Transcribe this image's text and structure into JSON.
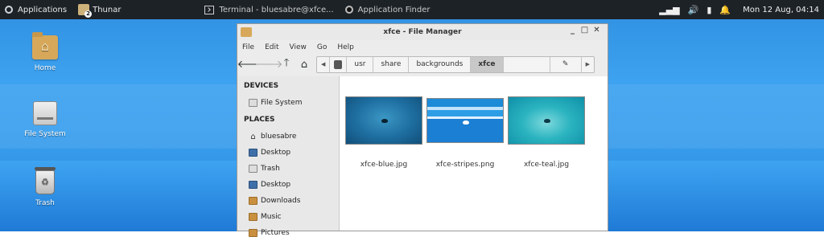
{
  "panel": {
    "applications_label": "Applications",
    "thunar_label": "Thunar",
    "thunar_badge": "2",
    "terminal_label": "Terminal - bluesabre@xfce...",
    "app_finder_label": "Application Finder",
    "clock": "Mon 12 Aug, 04:14",
    "tray_icons": [
      "signal-icon",
      "volume-icon",
      "battery-icon",
      "notification-bell-icon"
    ]
  },
  "desktop": {
    "icons": [
      {
        "label": "Home",
        "icon": "home-folder-icon"
      },
      {
        "label": "File System",
        "icon": "drive-icon"
      },
      {
        "label": "Trash",
        "icon": "trash-icon"
      }
    ]
  },
  "window": {
    "title": "xfce - File Manager",
    "controls": {
      "minimize": "_",
      "maximize": "□",
      "close": "✕"
    },
    "menu": [
      "File",
      "Edit",
      "View",
      "Go",
      "Help"
    ],
    "breadcrumbs": [
      "usr",
      "share",
      "backgrounds",
      "xfce"
    ],
    "current_crumb": "xfce",
    "sidebar": {
      "devices_header": "DEVICES",
      "devices": [
        {
          "label": "File System",
          "icon": "drive-icon"
        }
      ],
      "places_header": "PLACES",
      "places": [
        {
          "label": "bluesabre",
          "icon": "home-icon"
        },
        {
          "label": "Desktop",
          "icon": "desktop-icon"
        },
        {
          "label": "Trash",
          "icon": "trash-icon"
        },
        {
          "label": "Desktop",
          "icon": "desktop-icon"
        },
        {
          "label": "Downloads",
          "icon": "downloads-folder-icon"
        },
        {
          "label": "Music",
          "icon": "music-folder-icon"
        },
        {
          "label": "Pictures",
          "icon": "pictures-folder-icon"
        }
      ]
    },
    "files": [
      {
        "name": "xfce-blue.jpg"
      },
      {
        "name": "xfce-stripes.png"
      },
      {
        "name": "xfce-teal.jpg"
      }
    ]
  }
}
